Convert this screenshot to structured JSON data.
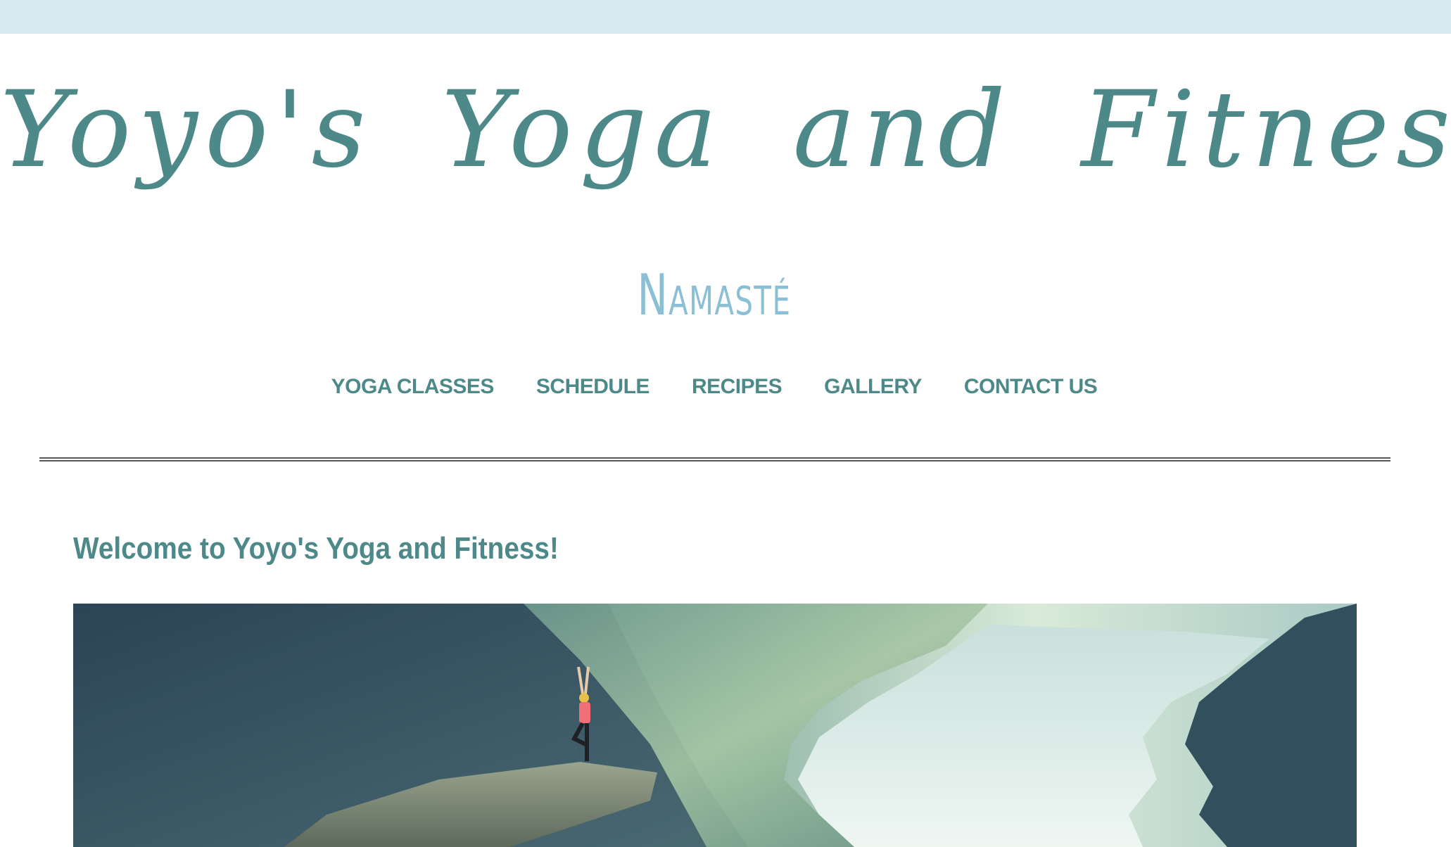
{
  "header": {
    "title": "Yoyo's Yoga and Fitness",
    "tagline": "Namasté"
  },
  "nav": {
    "items": [
      {
        "label": "YOGA CLASSES"
      },
      {
        "label": "SCHEDULE"
      },
      {
        "label": "RECIPES"
      },
      {
        "label": "GALLERY"
      },
      {
        "label": "CONTACT US"
      }
    ]
  },
  "main": {
    "heading": "Welcome to Yoyo's Yoga and Fitness!"
  },
  "colors": {
    "brand": "#4e898a",
    "tagline": "#8bbfd4",
    "top_band": "#d6e8f0"
  }
}
